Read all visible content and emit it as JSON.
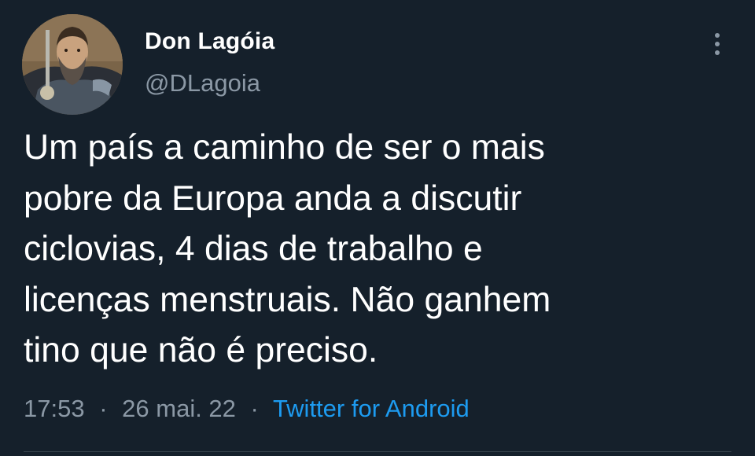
{
  "tweet": {
    "display_name": "Don Lagóia",
    "handle": "@DLagoia",
    "text_lines": [
      "Um país a caminho de ser o mais",
      "pobre da Europa anda a discutir",
      "ciclovias, 4 dias de trabalho e",
      "licenças menstruais. Não ganhem",
      "tino que não é preciso."
    ],
    "time": "17:53",
    "date": "26 mai. 22",
    "separator": "·",
    "source": "Twitter for Android"
  },
  "icons": {
    "more": "more-options-icon"
  },
  "colors": {
    "background": "#15202b",
    "primary_text": "#ffffff",
    "secondary_text": "#8b98a5",
    "link": "#1d9bf0",
    "divider": "#38444d"
  }
}
